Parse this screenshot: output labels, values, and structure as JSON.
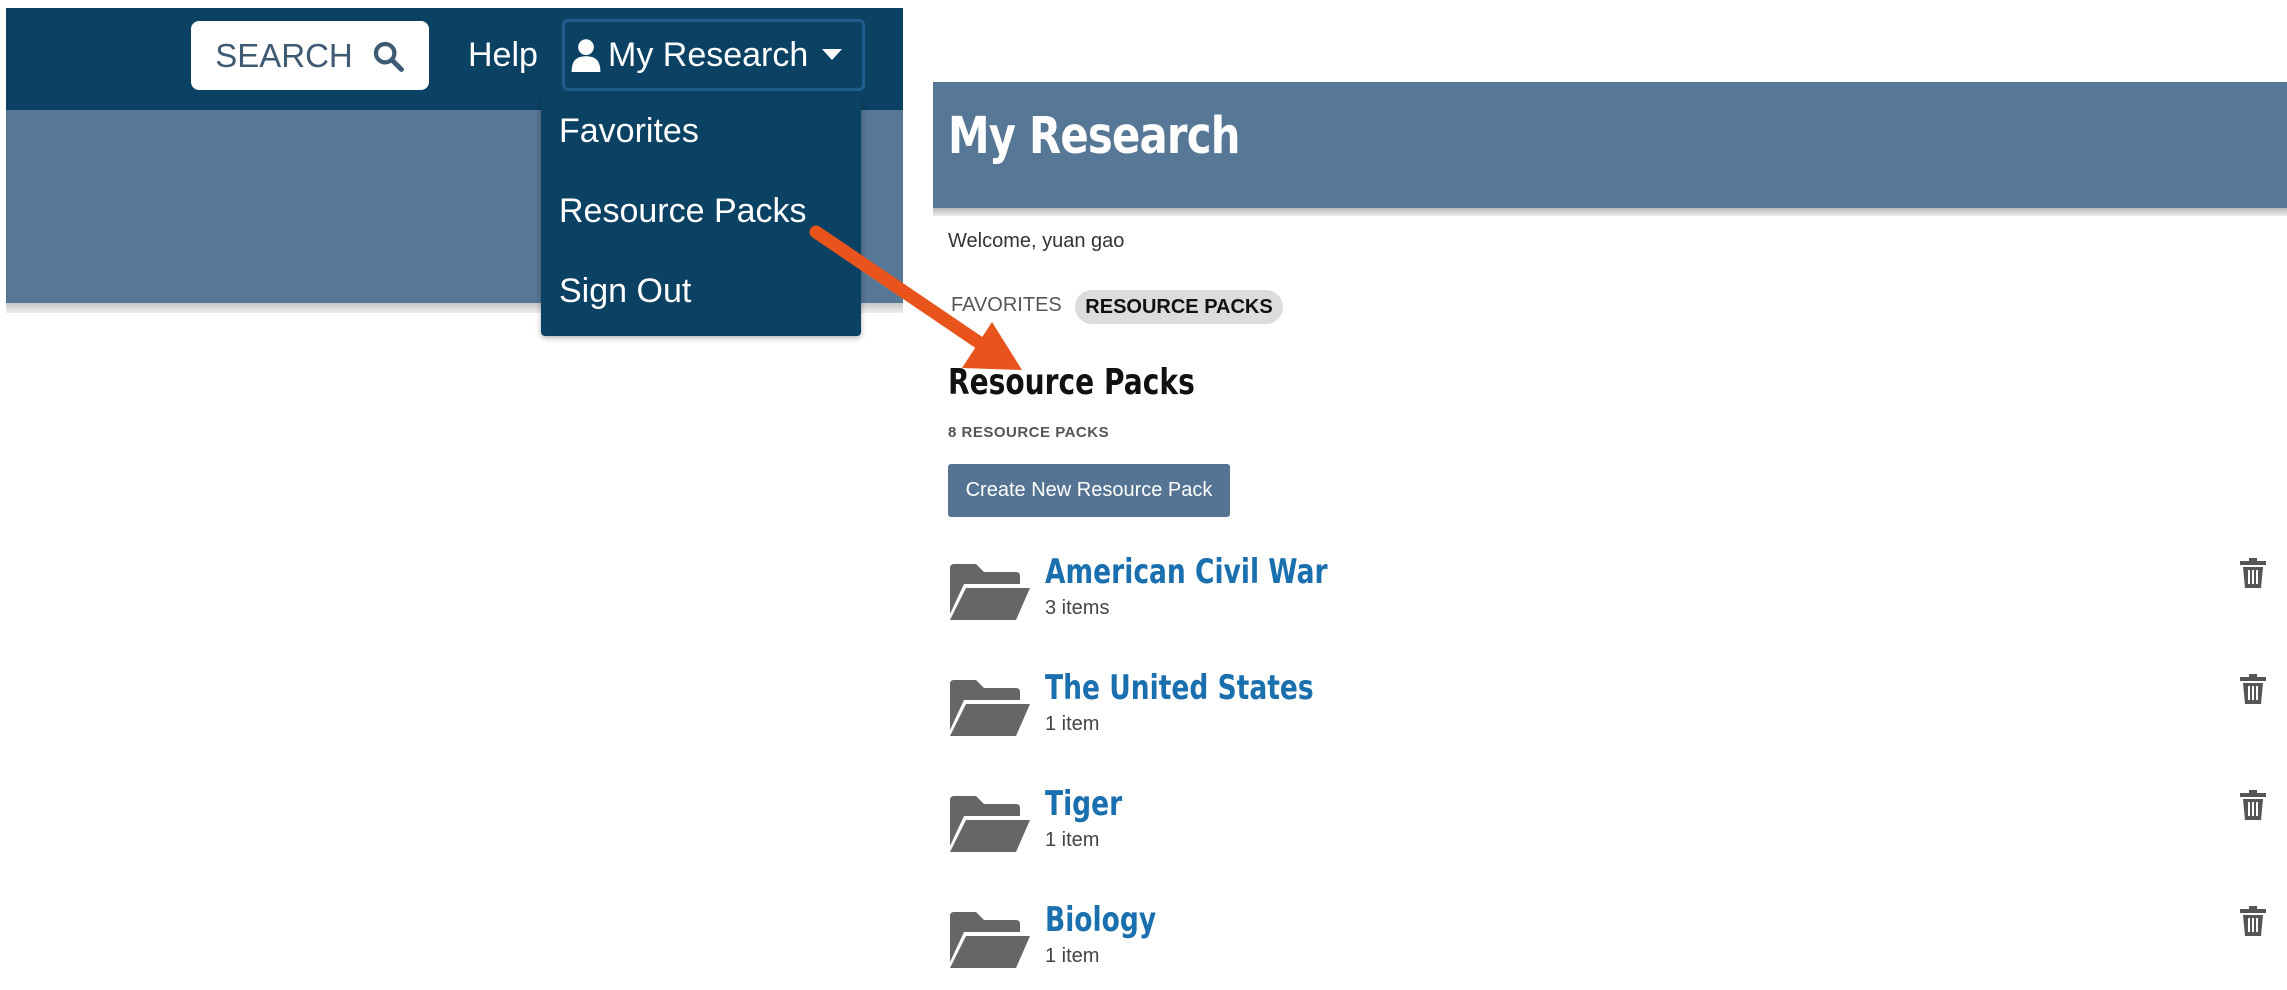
{
  "header": {
    "search_label": "SEARCH",
    "help_label": "Help",
    "my_research_label": "My Research"
  },
  "dropdown": {
    "items": [
      {
        "label": "Favorites"
      },
      {
        "label": "Resource Packs"
      },
      {
        "label": "Sign Out"
      }
    ]
  },
  "main": {
    "title": "My Research",
    "welcome": "Welcome, yuan gao",
    "tabs": [
      {
        "label": "FAVORITES",
        "active": false
      },
      {
        "label": "RESOURCE PACKS",
        "active": true
      }
    ],
    "section_title": "Resource Packs",
    "count_label": "8 RESOURCE PACKS",
    "create_button": "Create New Resource Pack",
    "packs": [
      {
        "name": "American Civil War",
        "items": "3 items"
      },
      {
        "name": "The United States",
        "items": "1 item"
      },
      {
        "name": "Tiger",
        "items": "1 item"
      },
      {
        "name": "Biology",
        "items": "1 item"
      }
    ]
  },
  "icons": {
    "search": "search-icon",
    "user": "user-icon",
    "caret": "caret-down-icon",
    "folder": "folder-open-icon",
    "trash": "trash-icon"
  },
  "colors": {
    "navy": "#0b4163",
    "banner": "#577796",
    "link": "#1a6fae",
    "arrow": "#e8541c"
  }
}
